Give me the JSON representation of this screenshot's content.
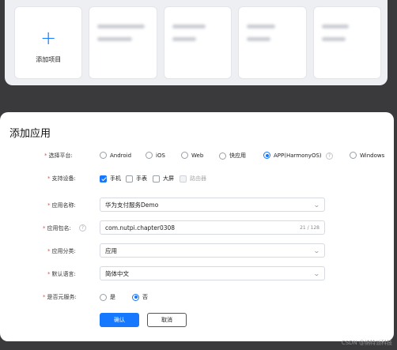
{
  "projects": {
    "add_label": "添加项目",
    "blurred_count": 4
  },
  "modal": {
    "title": "添加应用",
    "platform": {
      "label": "选择平台:",
      "options": [
        "Android",
        "iOS",
        "Web",
        "快应用",
        "APP(HarmonyOS)",
        "Windows"
      ],
      "selected": "APP(HarmonyOS)"
    },
    "devices": {
      "label": "支持设备:",
      "options": [
        "手机",
        "手表",
        "大屏",
        "路由器"
      ],
      "checked": [
        "手机"
      ],
      "disabled": [
        "路由器"
      ]
    },
    "app_name": {
      "label": "应用名称:",
      "value": "华为支付服务Demo"
    },
    "package": {
      "label": "应用包名:",
      "value": "com.nutpi.chapter0308",
      "counter": "21 / 128"
    },
    "category": {
      "label": "应用分类:",
      "value": "应用"
    },
    "language": {
      "label": "默认语言:",
      "value": "简体中文"
    },
    "meta_service": {
      "label": "是否元服务:",
      "options": [
        "是",
        "否"
      ],
      "selected": "否"
    },
    "confirm_label": "确认",
    "cancel_label": "取消"
  },
  "watermark": "CSDN @纳特派科技",
  "colors": {
    "accent": "#1677ff",
    "required": "#e34d59"
  }
}
